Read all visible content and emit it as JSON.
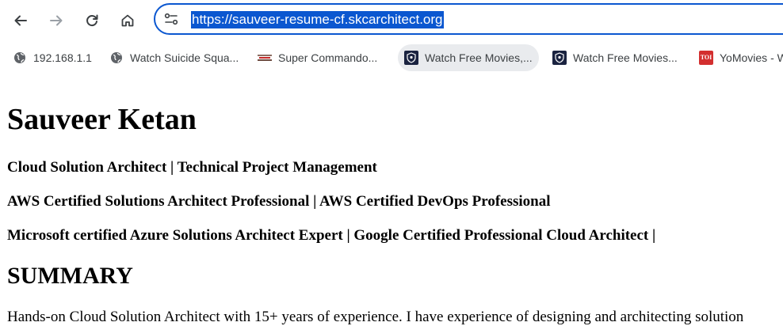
{
  "browser": {
    "url": "https://sauveer-resume-cf.skcarchitect.org",
    "accent_color": "#0b57d0",
    "buttons": {
      "back": "back-arrow-icon",
      "forward": "forward-arrow-icon",
      "reload": "reload-icon",
      "home": "home-icon",
      "site_info": "tune-icon"
    }
  },
  "bookmarks": [
    {
      "label": "192.168.1.1",
      "icon": "globe-icon"
    },
    {
      "label": "Watch Suicide Squa...",
      "icon": "globe-icon"
    },
    {
      "label": "Super Commando...",
      "icon": "site-favicon"
    },
    {
      "label": "Watch Free Movies,...",
      "icon": "shield-favicon"
    },
    {
      "label": "Watch Free Movies...",
      "icon": "shield-favicon"
    },
    {
      "label": "YoMovies - W",
      "icon": "toi-favicon",
      "icon_text": "TOI"
    }
  ],
  "page": {
    "name": "Sauveer Ketan",
    "headline1": "Cloud Solution Architect | Technical Project Management",
    "headline2": "AWS Certified Solutions Architect Professional | AWS Certified DevOps Professional",
    "headline3": "Microsoft certified Azure Solutions Architect Expert | Google Certified Professional Cloud Architect |",
    "summary_heading": "SUMMARY",
    "summary_text": "Hands-on Cloud Solution Architect with 15+ years of experience. I have experience of designing and architecting solution"
  }
}
